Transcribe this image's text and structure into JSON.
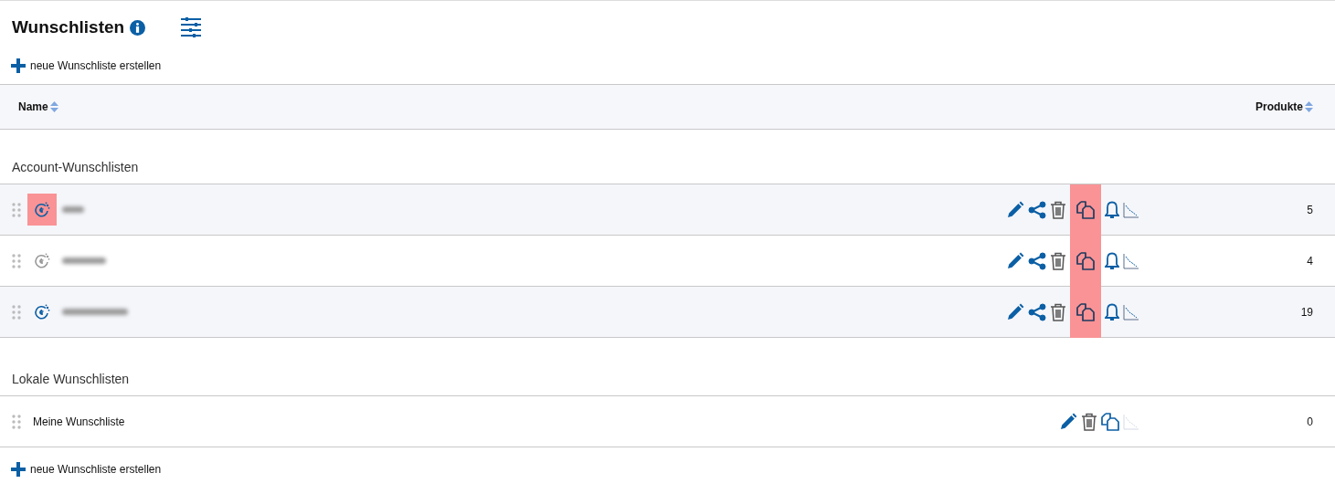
{
  "title": "Wunschlisten",
  "create_link_top": "neue Wunschliste erstellen",
  "columns": [
    {
      "label": "Name"
    },
    {
      "label": "Produkte"
    }
  ],
  "groups": [
    {
      "heading": "Account-Wunschlisten",
      "rows": [
        {
          "account_linked": true,
          "icon_highlighted": true,
          "count": "5",
          "actions": [
            {
              "kind": "edit",
              "disabled": false,
              "highlighted": false
            },
            {
              "kind": "share",
              "disabled": false,
              "highlighted": false
            },
            {
              "kind": "delete",
              "disabled": false,
              "highlighted": false
            },
            {
              "kind": "copy",
              "disabled": false,
              "highlighted": true
            },
            {
              "kind": "alert",
              "disabled": false,
              "highlighted": false
            },
            {
              "kind": "chart",
              "disabled": false,
              "highlighted": false
            }
          ]
        },
        {
          "account_linked": false,
          "icon_highlighted": false,
          "count": "4",
          "actions": [
            {
              "kind": "edit",
              "disabled": false,
              "highlighted": false
            },
            {
              "kind": "share",
              "disabled": false,
              "highlighted": false
            },
            {
              "kind": "delete",
              "disabled": false,
              "highlighted": false
            },
            {
              "kind": "copy",
              "disabled": false,
              "highlighted": true
            },
            {
              "kind": "alert",
              "disabled": false,
              "highlighted": false
            },
            {
              "kind": "chart",
              "disabled": false,
              "highlighted": false
            }
          ]
        },
        {
          "account_linked": true,
          "icon_highlighted": false,
          "count": "19",
          "actions": [
            {
              "kind": "edit",
              "disabled": false,
              "highlighted": false
            },
            {
              "kind": "share",
              "disabled": false,
              "highlighted": false
            },
            {
              "kind": "delete",
              "disabled": false,
              "highlighted": false
            },
            {
              "kind": "copy",
              "disabled": false,
              "highlighted": true
            },
            {
              "kind": "alert",
              "disabled": false,
              "highlighted": false
            },
            {
              "kind": "chart",
              "disabled": false,
              "highlighted": false
            }
          ]
        }
      ]
    },
    {
      "heading": "Lokale Wunschlisten",
      "rows": [
        {
          "name": "Meine Wunschliste",
          "count": "0",
          "actions": [
            {
              "kind": "edit",
              "disabled": false,
              "highlighted": false
            },
            {
              "kind": "delete",
              "disabled": false,
              "highlighted": false
            },
            {
              "kind": "copy",
              "disabled": false,
              "highlighted": false
            },
            {
              "kind": "chart",
              "disabled": true,
              "highlighted": false
            }
          ]
        }
      ]
    }
  ],
  "create_link_bottom": "neue Wunschliste erstellen"
}
